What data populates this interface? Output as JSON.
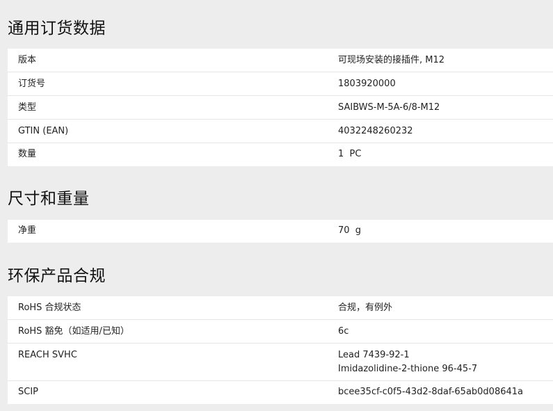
{
  "sections": [
    {
      "title": "通用订货数据",
      "rows": [
        {
          "label": "版本",
          "value": "可现场安装的接插件, M12"
        },
        {
          "label": "订货号",
          "value": "1803920000"
        },
        {
          "label": "类型",
          "value": "SAIBWS-M-5A-6/8-M12"
        },
        {
          "label": "GTIN (EAN)",
          "value": "4032248260232"
        },
        {
          "label": "数量",
          "value": "1  PC"
        }
      ]
    },
    {
      "title": "尺寸和重量",
      "rows": [
        {
          "label": "净重",
          "value": "70  g"
        }
      ]
    },
    {
      "title": "环保产品合规",
      "rows": [
        {
          "label": "RoHS 合规状态",
          "value": "合规，有例外"
        },
        {
          "label": "RoHS 豁免（如适用/已知）",
          "value": "6c"
        },
        {
          "label": "REACH SVHC",
          "value_lines": [
            "Lead 7439-92-1",
            "Imidazolidine-2-thione 96-45-7"
          ]
        },
        {
          "label": "SCIP",
          "value": "bcee35cf-c0f5-43d2-8daf-65ab0d08641a"
        }
      ]
    }
  ]
}
